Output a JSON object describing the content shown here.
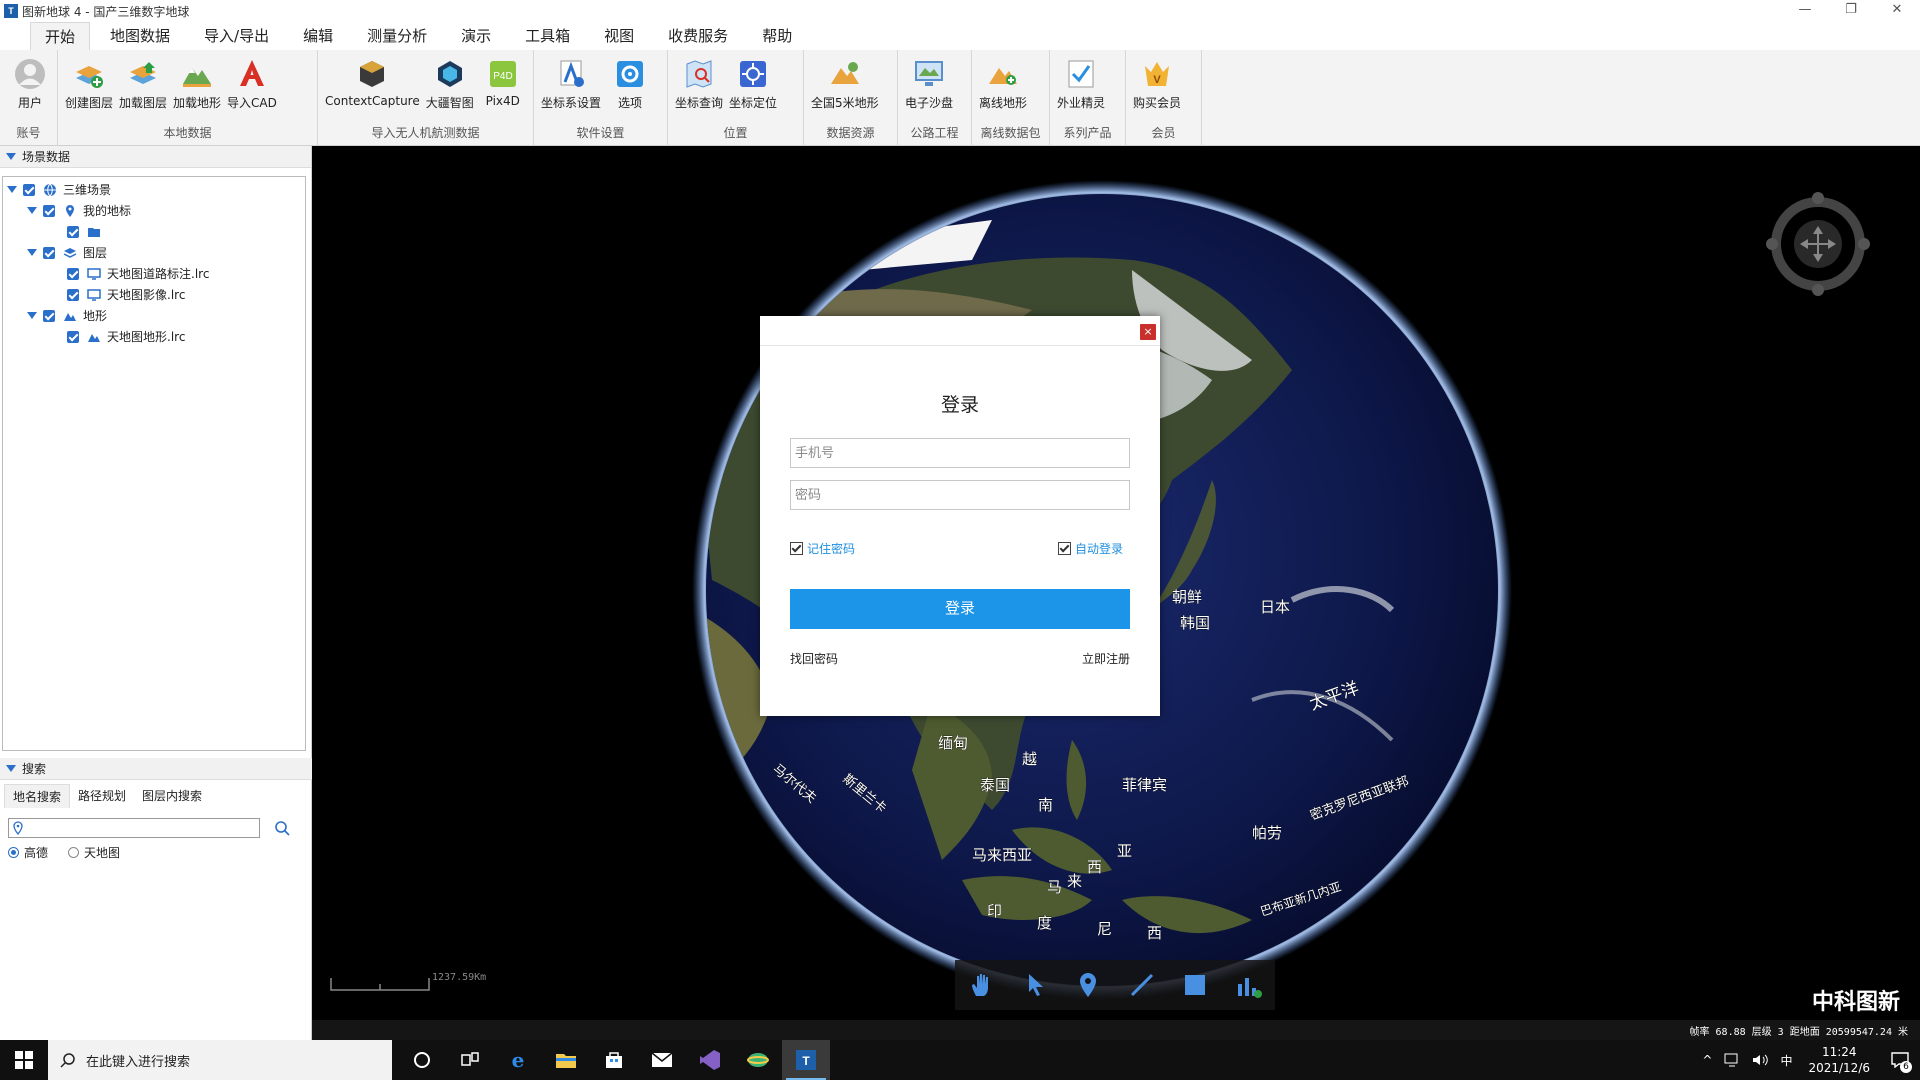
{
  "window": {
    "title": "图新地球 4 - 国产三维数字地球",
    "controls": [
      "—",
      "❐",
      "✕"
    ]
  },
  "menu": [
    "开始",
    "地图数据",
    "导入/导出",
    "编辑",
    "测量分析",
    "演示",
    "工具箱",
    "视图",
    "收费服务",
    "帮助"
  ],
  "ribbon": {
    "groups": [
      {
        "label": "账号",
        "items": [
          "用户"
        ]
      },
      {
        "label": "本地数据",
        "items": [
          "创建图层",
          "加载图层",
          "加载地形",
          "导入CAD"
        ]
      },
      {
        "label": "导入无人机航测数据",
        "items": [
          "ContextCapture",
          "大疆智图",
          "Pix4D"
        ]
      },
      {
        "label": "软件设置",
        "items": [
          "坐标系设置",
          "选项"
        ]
      },
      {
        "label": "位置",
        "items": [
          "坐标查询",
          "坐标定位"
        ]
      },
      {
        "label": "数据资源",
        "items": [
          "全国5米地形"
        ]
      },
      {
        "label": "公路工程",
        "items": [
          "电子沙盘"
        ]
      },
      {
        "label": "离线数据包",
        "items": [
          "离线地形"
        ]
      },
      {
        "label": "系列产品",
        "items": [
          "外业精灵"
        ]
      },
      {
        "label": "会员",
        "items": [
          "购买会员"
        ]
      }
    ]
  },
  "scene": {
    "header": "场景数据",
    "tree": {
      "root": "三维场景",
      "landmarks": "我的地标",
      "layers": "图层",
      "layer1": "天地图道路标注.lrc",
      "layer2": "天地图影像.lrc",
      "terrain": "地形",
      "terrain1": "天地图地形.lrc"
    }
  },
  "search": {
    "header": "搜索",
    "tabs": [
      "地名搜索",
      "路径规划",
      "图层内搜索"
    ],
    "input_value": "",
    "source_options": [
      "高德",
      "天地图"
    ],
    "source_selected": "高德"
  },
  "map": {
    "labels": {
      "korea_n": "朝鲜",
      "korea_s": "韩国",
      "japan": "日本",
      "pacific": "太平洋",
      "myanmar": "缅甸",
      "vietnam": "越",
      "nan": "南",
      "thailand": "泰国",
      "philippines": "菲律宾",
      "micronesia": "密克罗尼西亚联邦",
      "palau": "帕劳",
      "malaysia": "马来西亚",
      "lanka": "斯里兰卡",
      "maldives": "马尔代夫",
      "indonesia_a": "亚",
      "indonesia_b": "西",
      "indonesia_c": "来",
      "indonesia_d": "马",
      "indo_e": "印",
      "indo_f": "度",
      "indo_g": "尼",
      "indo_h": "西",
      "png": "巴布亚新几内亚"
    },
    "scale_text": "1237.59Km",
    "brand": "中科图新",
    "status": "帧率 68.88  层级 3  距地面 20599547.24 米",
    "bottom_tools": [
      "hand-icon",
      "pointer-icon",
      "pin-icon",
      "line-icon",
      "polygon-icon",
      "chart-icon"
    ]
  },
  "login": {
    "title": "登录",
    "close": "×",
    "phone_placeholder": "手机号",
    "password_placeholder": "密码",
    "remember": "记住密码",
    "auto_login": "自动登录",
    "submit": "登录",
    "forgot": "找回密码",
    "register": "立即注册"
  },
  "taskbar": {
    "search_placeholder": "在此键入进行搜索",
    "time": "11:24",
    "date": "2021/12/6",
    "ime": "中",
    "notifications": "6"
  },
  "colors": {
    "accent": "#1c95e8",
    "ribbon_bg": "#f3f3f3",
    "tree_check": "#2a6fc9",
    "close_red": "#c9302c",
    "taskbar": "#101010"
  }
}
